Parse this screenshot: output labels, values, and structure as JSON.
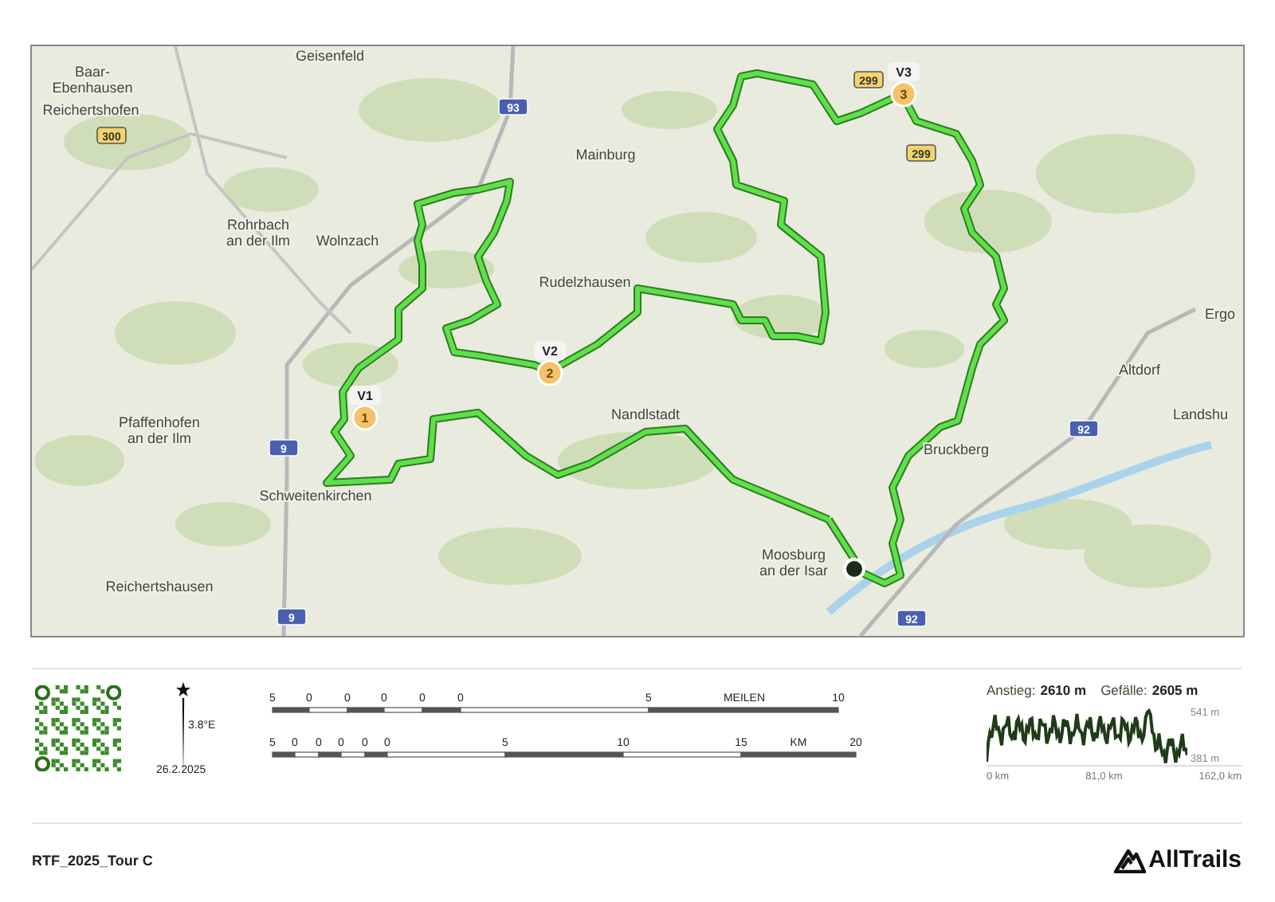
{
  "map": {
    "places": [
      {
        "lines": [
          "Geisenfeld"
        ]
      },
      {
        "lines": [
          "Baar-",
          "Ebenhausen"
        ]
      },
      {
        "lines": [
          "Reichertshofen"
        ]
      },
      {
        "lines": [
          "Mainburg"
        ]
      },
      {
        "lines": [
          "Rohrbach",
          "an der Ilm"
        ]
      },
      {
        "lines": [
          "Wolnzach"
        ]
      },
      {
        "lines": [
          "Rudelzhausen"
        ]
      },
      {
        "lines": [
          "Pfaffenhofen",
          "an der Ilm"
        ]
      },
      {
        "lines": [
          "Schweitenkirchen"
        ]
      },
      {
        "lines": [
          "Reichertshausen"
        ]
      },
      {
        "lines": [
          "Nandlstadt"
        ]
      },
      {
        "lines": [
          "Bruckberg"
        ]
      },
      {
        "lines": [
          "Altdorf"
        ]
      },
      {
        "lines": [
          "Landshu"
        ]
      },
      {
        "lines": [
          "Ergo"
        ]
      },
      {
        "lines": [
          "Moosburg",
          "an der Isar"
        ]
      }
    ],
    "road_shields": [
      {
        "label": "93",
        "kind": "autobahn"
      },
      {
        "label": "300",
        "kind": "federal"
      },
      {
        "label": "299",
        "kind": "federal"
      },
      {
        "label": "299",
        "kind": "federal"
      },
      {
        "label": "9",
        "kind": "autobahn"
      },
      {
        "label": "9",
        "kind": "autobahn"
      },
      {
        "label": "92",
        "kind": "autobahn"
      },
      {
        "label": "92",
        "kind": "autobahn"
      }
    ],
    "waypoints": [
      {
        "label": "V1",
        "number": "1"
      },
      {
        "label": "V2",
        "number": "2"
      },
      {
        "label": "V3",
        "number": "3"
      }
    ]
  },
  "footer": {
    "declination": "3.8°E",
    "date": "26.2.2025",
    "scale_miles": [
      {
        "label": "5",
        "kind": "tick"
      },
      {
        "label": "0",
        "kind": "tick"
      },
      {
        "label": "0",
        "kind": "tick"
      },
      {
        "label": "0",
        "kind": "tick"
      },
      {
        "label": "0",
        "kind": "tick"
      },
      {
        "label": "0",
        "kind": "tick"
      },
      {
        "label": "5",
        "kind": "tick"
      },
      {
        "label": "MEILEN",
        "kind": "unit"
      },
      {
        "label": "10",
        "kind": "tick"
      }
    ],
    "scale_km": [
      {
        "label": "5",
        "kind": "tick"
      },
      {
        "label": "0",
        "kind": "tick"
      },
      {
        "label": "0",
        "kind": "tick"
      },
      {
        "label": "0",
        "kind": "tick"
      },
      {
        "label": "0",
        "kind": "tick"
      },
      {
        "label": "0",
        "kind": "tick"
      },
      {
        "label": "5",
        "kind": "tick"
      },
      {
        "label": "10",
        "kind": "tick"
      },
      {
        "label": "15",
        "kind": "tick"
      },
      {
        "label": "KM",
        "kind": "unit"
      },
      {
        "label": "20",
        "kind": "tick"
      }
    ]
  },
  "elevation": {
    "gain_label": "Anstieg:",
    "gain": "2610 m",
    "loss_label": "Gefälle:",
    "loss": "2605 m",
    "max": "541 m",
    "min": "381 m",
    "x_labels": [
      "0 km",
      "81,0 km",
      "162,0 km"
    ]
  },
  "title": "RTF_2025_Tour C",
  "brand": "AllTrails"
}
